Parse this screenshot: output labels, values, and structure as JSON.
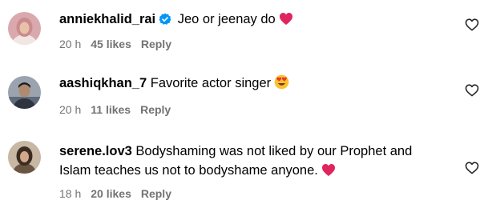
{
  "comments": [
    {
      "username": "anniekhalid_rai",
      "verified": true,
      "text": "Jeo or jeenay do",
      "emoji": "red-heart",
      "time": "20 h",
      "likes": "45 likes",
      "reply": "Reply"
    },
    {
      "username": "aashiqkhan_7",
      "verified": false,
      "text": "Favorite actor singer",
      "emoji": "heart-eyes-face",
      "time": "20 h",
      "likes": "11 likes",
      "reply": "Reply"
    },
    {
      "username": "serene.lov3",
      "verified": false,
      "text": "Bodyshaming was not liked by our Prophet and Islam teaches us not to bodyshame anyone.",
      "emoji": "red-heart",
      "time": "18 h",
      "likes": "20 likes",
      "reply": "Reply"
    }
  ],
  "colors": {
    "verified": "#0095f6",
    "meta_text": "#737373",
    "heart_emoji": "#e0245e"
  },
  "icons": {
    "like_button": "heart-outline-icon",
    "verified_badge": "verified-badge-icon"
  }
}
